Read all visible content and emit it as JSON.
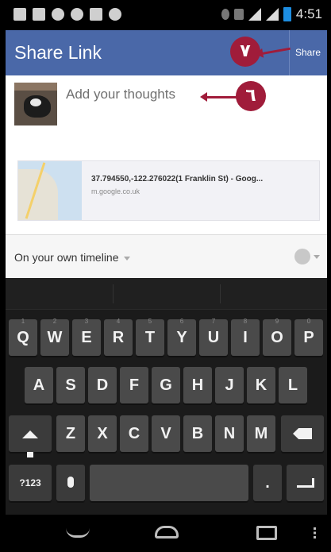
{
  "status_bar": {
    "time": "4:51"
  },
  "action_bar": {
    "title": "Share Link",
    "share_label": "Share"
  },
  "callouts": {
    "share": "٧",
    "thoughts": "٦"
  },
  "composer": {
    "placeholder": "Add your thoughts",
    "link_title": "37.794550,-122.276022(1 Franklin St) - Goog...",
    "link_domain": "m.google.co.uk"
  },
  "audience": {
    "label": "On your own timeline"
  },
  "keyboard": {
    "row1": [
      {
        "k": "Q",
        "h": "1"
      },
      {
        "k": "W",
        "h": "2"
      },
      {
        "k": "E",
        "h": "3"
      },
      {
        "k": "R",
        "h": "4"
      },
      {
        "k": "T",
        "h": "5"
      },
      {
        "k": "Y",
        "h": "6"
      },
      {
        "k": "U",
        "h": "7"
      },
      {
        "k": "I",
        "h": "8"
      },
      {
        "k": "O",
        "h": "9"
      },
      {
        "k": "P",
        "h": "0"
      }
    ],
    "row2": [
      "A",
      "S",
      "D",
      "F",
      "G",
      "H",
      "J",
      "K",
      "L"
    ],
    "row3": [
      "Z",
      "X",
      "C",
      "V",
      "B",
      "N",
      "M"
    ],
    "symbols_label": "?123",
    "period_label": "."
  }
}
